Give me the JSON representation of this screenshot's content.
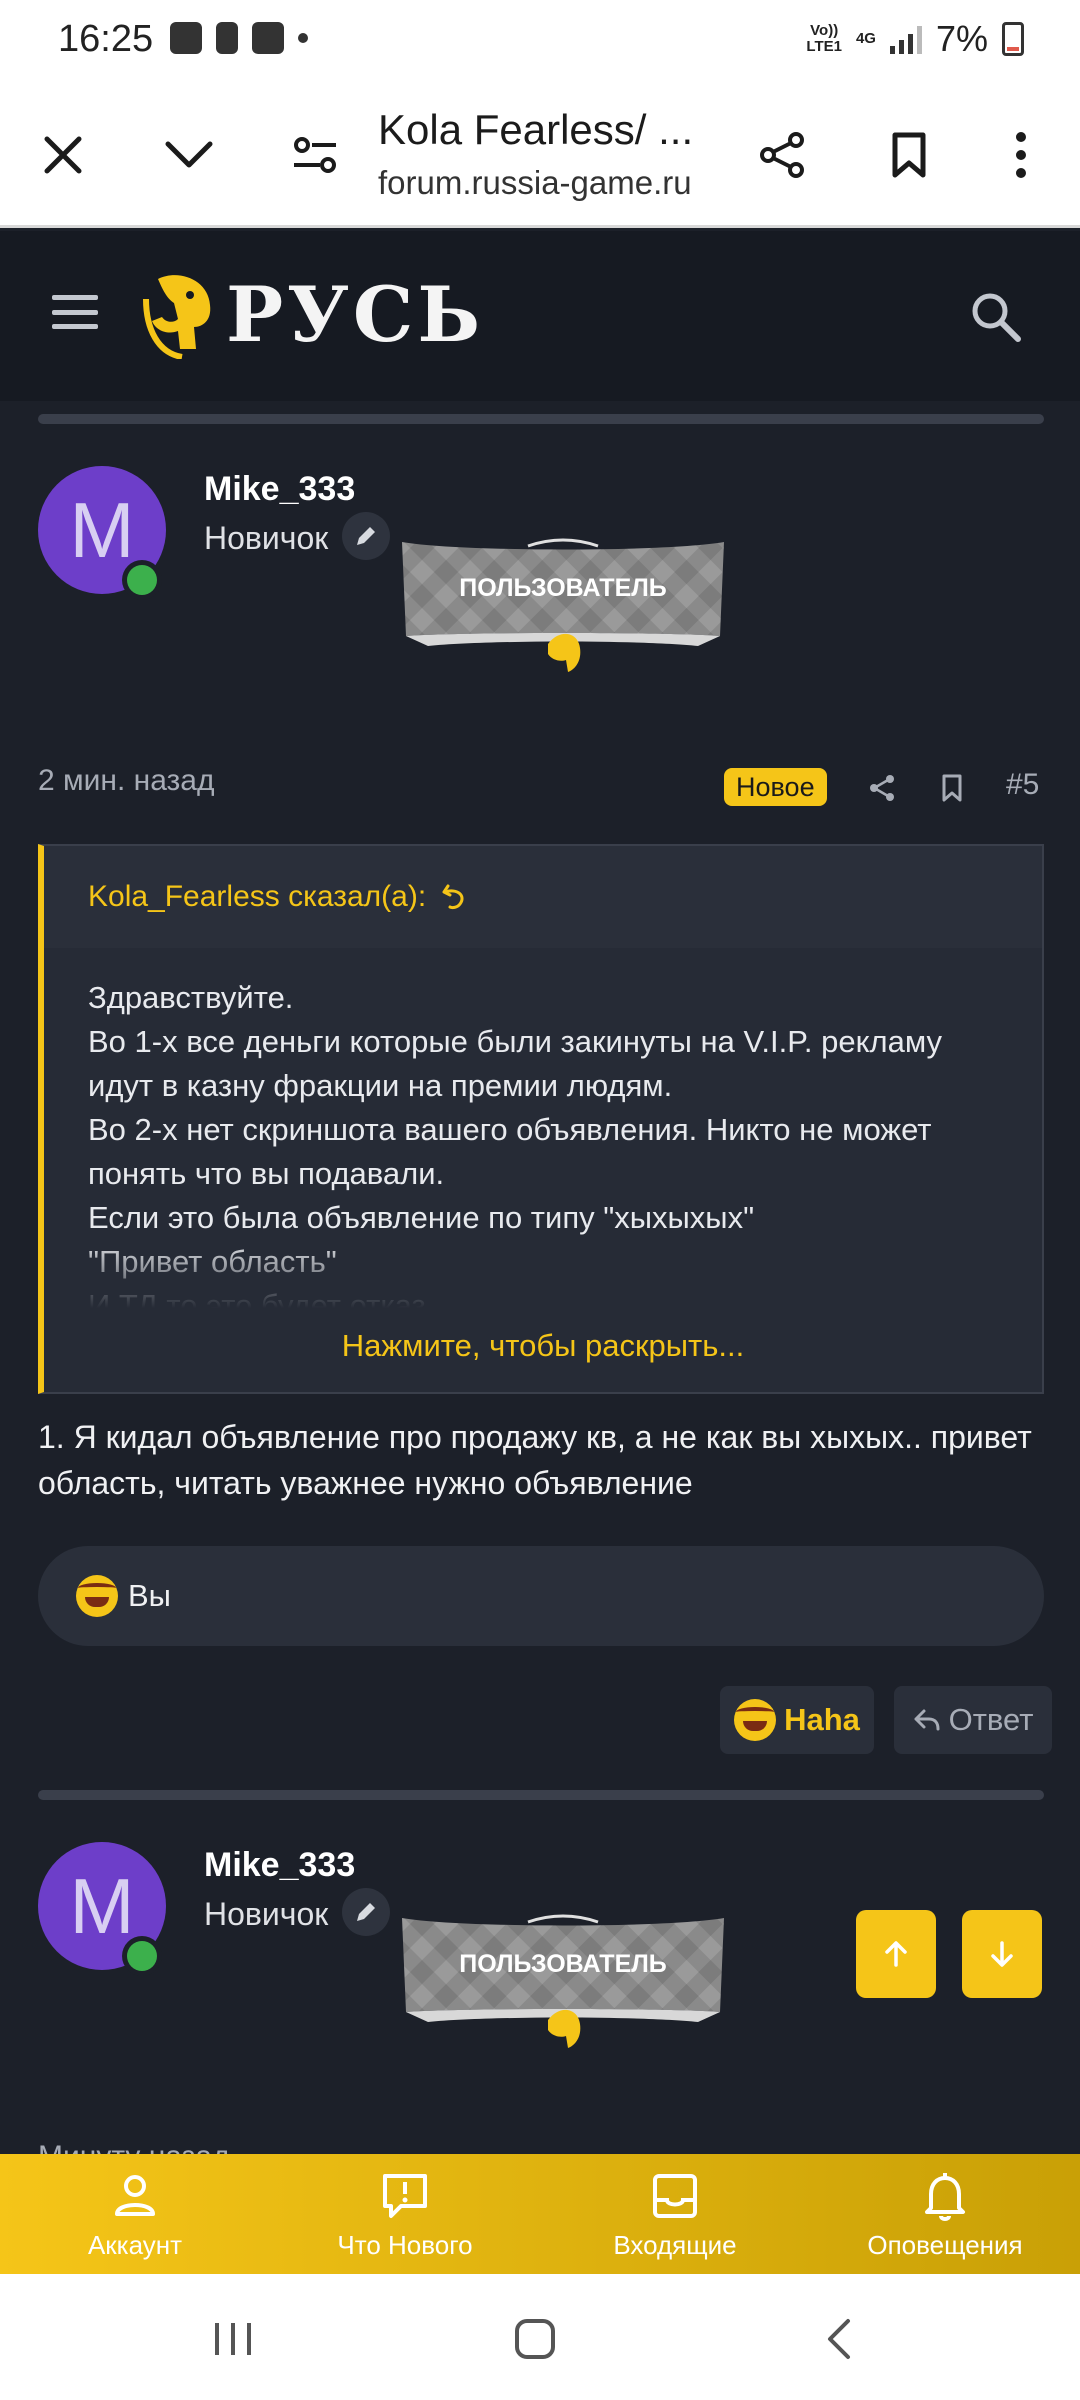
{
  "status_bar": {
    "time": "16:25",
    "network_top": "Vo))",
    "network_bottom": "LTE1",
    "network_type": "4G",
    "battery": "7%"
  },
  "browser": {
    "title": "Kola Fearless/ ...",
    "url": "forum.russia-game.ru"
  },
  "site": {
    "logo_text": "РУСЬ"
  },
  "posts": [
    {
      "avatar_letter": "M",
      "username": "Mike_333",
      "user_title": "Новичок",
      "banner_label": "ПОЛЬЗОВАТЕЛЬ",
      "time": "2 мин. назад",
      "badge": "Новое",
      "number": "#5",
      "quote": {
        "author": "Kola_Fearless сказал(а):",
        "lines": [
          "Здравствуйте.",
          "Во 1-х все деньги которые были закинуты на V.I.P. рекламу идут в казну фракции на премии людям.",
          "Во 2-х нет скриншота вашего объявления. Никто не может понять что вы подавали.",
          "Если это была объявление по типу \"хыхыхых\"",
          "\"Привет область\"",
          "И.ТД то это будет отказ."
        ],
        "expand_label": "Нажмите, чтобы раскрыть..."
      },
      "text": "1. Я кидал объявление про продажу кв, а не как вы хыхых.. привет область, читать уважнее нужно объявление",
      "reactions_label": "Вы",
      "haha_label": "Haha",
      "reply_label": "Ответ"
    },
    {
      "avatar_letter": "M",
      "username": "Mike_333",
      "user_title": "Новичок",
      "banner_label": "ПОЛЬЗОВАТЕЛЬ",
      "time": "Минуту назад"
    }
  ],
  "bottom_nav": [
    {
      "label": "Аккаунт",
      "icon": "user-icon"
    },
    {
      "label": "Что Нового",
      "icon": "alert-bubble-icon"
    },
    {
      "label": "Входящие",
      "icon": "inbox-icon"
    },
    {
      "label": "Оповещения",
      "icon": "bell-icon"
    }
  ],
  "colors": {
    "accent": "#f5c518",
    "background": "#1c2029",
    "avatar": "#6d3ec9",
    "online": "#3cb04c"
  }
}
